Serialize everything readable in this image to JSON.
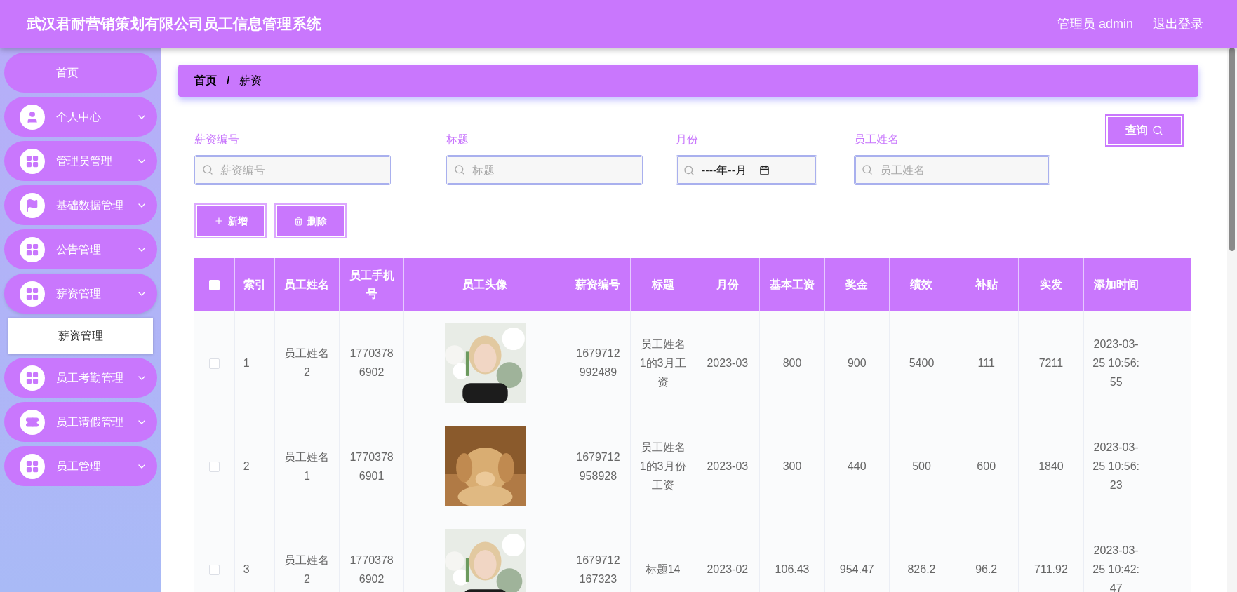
{
  "header": {
    "title": "武汉君耐营销策划有限公司员工信息管理系统",
    "user": "管理员 admin",
    "logout": "退出登录"
  },
  "sidebar": {
    "items": [
      {
        "label": "首页",
        "kind": "link",
        "expanded": false
      },
      {
        "label": "个人中心",
        "kind": "menu",
        "expanded": false
      },
      {
        "label": "管理员管理",
        "kind": "menu",
        "expanded": false
      },
      {
        "label": "基础数据管理",
        "kind": "menu",
        "expanded": false
      },
      {
        "label": "公告管理",
        "kind": "menu",
        "expanded": false
      },
      {
        "label": "薪资管理",
        "kind": "menu",
        "expanded": true,
        "children": [
          {
            "label": "薪资管理",
            "selected": true
          }
        ]
      },
      {
        "label": "员工考勤管理",
        "kind": "menu",
        "expanded": false
      },
      {
        "label": "员工请假管理",
        "kind": "menu",
        "expanded": false
      },
      {
        "label": "员工管理",
        "kind": "menu",
        "expanded": false
      }
    ]
  },
  "breadcrumb": {
    "items": [
      "首页",
      "薪资"
    ],
    "separator": "/"
  },
  "search": {
    "fields": [
      {
        "label": "薪资编号",
        "placeholder": "薪资编号",
        "kind": "text"
      },
      {
        "label": "标题",
        "placeholder": "标题",
        "kind": "text"
      },
      {
        "label": "月份",
        "value": "----年--月",
        "kind": "month"
      },
      {
        "label": "员工姓名",
        "placeholder": "员工姓名",
        "kind": "text"
      }
    ],
    "button": "查询"
  },
  "actions": [
    {
      "label": "新增",
      "kind": "add"
    },
    {
      "label": "删除",
      "kind": "delete"
    }
  ],
  "table": {
    "all_checked": false,
    "columns": [
      "索引",
      "员工姓名",
      "员工手机号",
      "员工头像",
      "薪资编号",
      "标题",
      "月份",
      "基本工资",
      "奖金",
      "绩效",
      "补贴",
      "实发",
      "添加时间"
    ],
    "rows": [
      {
        "checked": false,
        "cells": [
          "1",
          "员工姓名2",
          "17703786902",
          "",
          "1679712992489",
          "员工姓名1的3月工资",
          "2023-03",
          "800",
          "900",
          "5400",
          "111",
          "7211",
          "2023-03-25 10:56:55"
        ]
      },
      {
        "checked": false,
        "cells": [
          "2",
          "员工姓名1",
          "17703786901",
          "",
          "1679712958928",
          "员工姓名1的3月份工资",
          "2023-03",
          "300",
          "440",
          "500",
          "600",
          "1840",
          "2023-03-25 10:56:23"
        ]
      },
      {
        "checked": false,
        "cells": [
          "3",
          "员工姓名2",
          "17703786902",
          "",
          "1679712167323",
          "标题14",
          "2023-02",
          "106.43",
          "954.47",
          "826.2",
          "96.2",
          "711.92",
          "2023-03-25 10:42:47"
        ]
      }
    ]
  }
}
